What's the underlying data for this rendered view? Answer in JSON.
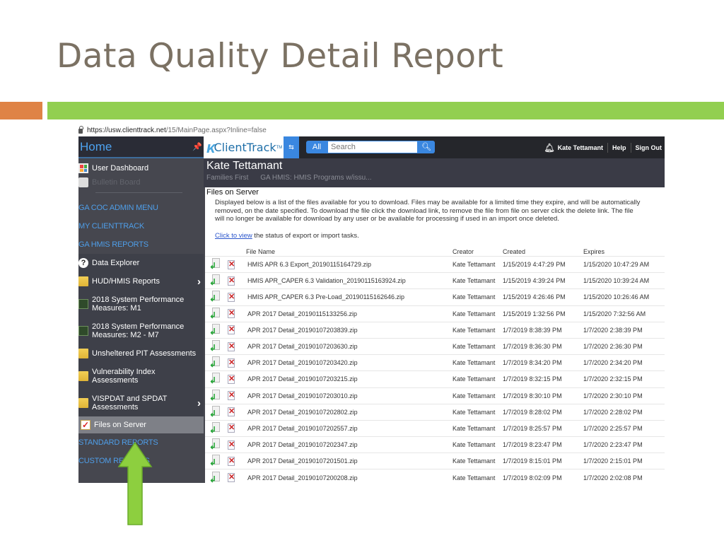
{
  "slide": {
    "title": "Data Quality Detail Report",
    "colors": {
      "title": "#7b7163",
      "orange_accent": "#df8346",
      "green_accent": "#92cf50",
      "arrow": "#8dcf3f"
    }
  },
  "browser": {
    "url_host": "https://usw.clienttrack.net",
    "url_path": "/15/MainPage.aspx?Inline=false"
  },
  "sidebar": {
    "home_label": "Home",
    "top_items": [
      {
        "label": "User Dashboard",
        "icon": "dashboard-icon"
      },
      {
        "label": "Bulletin Board",
        "icon": "bulletin-board-icon"
      }
    ],
    "section_links": [
      "GA COC ADMIN MENU",
      "MY CLIENTTRACK",
      "GA HMIS REPORTS"
    ],
    "report_items": [
      {
        "label": "Data Explorer",
        "icon": "question-icon",
        "chevron": false
      },
      {
        "label": "HUD/HMIS Reports",
        "icon": "folder-icon",
        "chevron": true
      },
      {
        "label": "2018 System Performance Measures: M1",
        "icon": "chart-icon",
        "chevron": false
      },
      {
        "label": "2018 System Performance Measures: M2 - M7",
        "icon": "chart-icon",
        "chevron": false
      },
      {
        "label": "Unsheltered PIT Assessments",
        "icon": "folder-icon",
        "chevron": false
      },
      {
        "label": "Vulnerability Index Assessments",
        "icon": "folder-icon",
        "chevron": false
      },
      {
        "label": "VISPDAT and SPDAT Assessments",
        "icon": "folder-icon",
        "chevron": true
      },
      {
        "label": "Files on Server",
        "icon": "checklist-icon",
        "chevron": false,
        "selected": true
      }
    ],
    "bottom_links": [
      "STANDARD REPORTS",
      "CUSTOM REPORTS"
    ]
  },
  "topbar": {
    "logo_text": "ClientTrack",
    "logo_tm": "TM",
    "search_scope": "All",
    "search_placeholder": "Search",
    "user_name": "Kate Tettamant",
    "help_label": "Help",
    "signout_label": "Sign Out"
  },
  "context": {
    "client_name": "Kate Tettamant",
    "org": "Families First",
    "program": "GA HMIS: HMIS Programs w/issu..."
  },
  "content": {
    "title": "Files on Server",
    "description": "Displayed below is a list of the files available for you to download. Files may be available for a limited time they expire, and will be automatically removed, on the date specified. To download the file click the download link, to remove the file from file on server click the delete link. The file will no longer be available for download by any user or be available for processing if used in an import once deleted.",
    "click_link": "Click to view",
    "click_rest": " the status of export or import tasks.",
    "columns": [
      "File Name",
      "Creator",
      "Created",
      "Expires"
    ],
    "rows": [
      {
        "file": "HMIS APR 6.3 Export_20190115164729.zip",
        "creator": "Kate Tettamant",
        "created": "1/15/2019 4:47:29 PM",
        "expires": "1/15/2020 10:47:29 AM"
      },
      {
        "file": "HMIS APR_CAPER 6.3 Validation_20190115163924.zip",
        "creator": "Kate Tettamant",
        "created": "1/15/2019 4:39:24 PM",
        "expires": "1/15/2020 10:39:24 AM"
      },
      {
        "file": "HMIS APR_CAPER 6.3 Pre-Load_20190115162646.zip",
        "creator": "Kate Tettamant",
        "created": "1/15/2019 4:26:46 PM",
        "expires": "1/15/2020 10:26:46 AM"
      },
      {
        "file": "APR 2017 Detail_20190115133256.zip",
        "creator": "Kate Tettamant",
        "created": "1/15/2019 1:32:56 PM",
        "expires": "1/15/2020 7:32:56 AM"
      },
      {
        "file": "APR 2017 Detail_20190107203839.zip",
        "creator": "Kate Tettamant",
        "created": "1/7/2019 8:38:39 PM",
        "expires": "1/7/2020 2:38:39 PM"
      },
      {
        "file": "APR 2017 Detail_20190107203630.zip",
        "creator": "Kate Tettamant",
        "created": "1/7/2019 8:36:30 PM",
        "expires": "1/7/2020 2:36:30 PM"
      },
      {
        "file": "APR 2017 Detail_20190107203420.zip",
        "creator": "Kate Tettamant",
        "created": "1/7/2019 8:34:20 PM",
        "expires": "1/7/2020 2:34:20 PM"
      },
      {
        "file": "APR 2017 Detail_20190107203215.zip",
        "creator": "Kate Tettamant",
        "created": "1/7/2019 8:32:15 PM",
        "expires": "1/7/2020 2:32:15 PM"
      },
      {
        "file": "APR 2017 Detail_20190107203010.zip",
        "creator": "Kate Tettamant",
        "created": "1/7/2019 8:30:10 PM",
        "expires": "1/7/2020 2:30:10 PM"
      },
      {
        "file": "APR 2017 Detail_20190107202802.zip",
        "creator": "Kate Tettamant",
        "created": "1/7/2019 8:28:02 PM",
        "expires": "1/7/2020 2:28:02 PM"
      },
      {
        "file": "APR 2017 Detail_20190107202557.zip",
        "creator": "Kate Tettamant",
        "created": "1/7/2019 8:25:57 PM",
        "expires": "1/7/2020 2:25:57 PM"
      },
      {
        "file": "APR 2017 Detail_20190107202347.zip",
        "creator": "Kate Tettamant",
        "created": "1/7/2019 8:23:47 PM",
        "expires": "1/7/2020 2:23:47 PM"
      },
      {
        "file": "APR 2017 Detail_20190107201501.zip",
        "creator": "Kate Tettamant",
        "created": "1/7/2019 8:15:01 PM",
        "expires": "1/7/2020 2:15:01 PM"
      },
      {
        "file": "APR 2017 Detail_20190107200208.zip",
        "creator": "Kate Tettamant",
        "created": "1/7/2019 8:02:09 PM",
        "expires": "1/7/2020 2:02:08 PM"
      }
    ]
  }
}
